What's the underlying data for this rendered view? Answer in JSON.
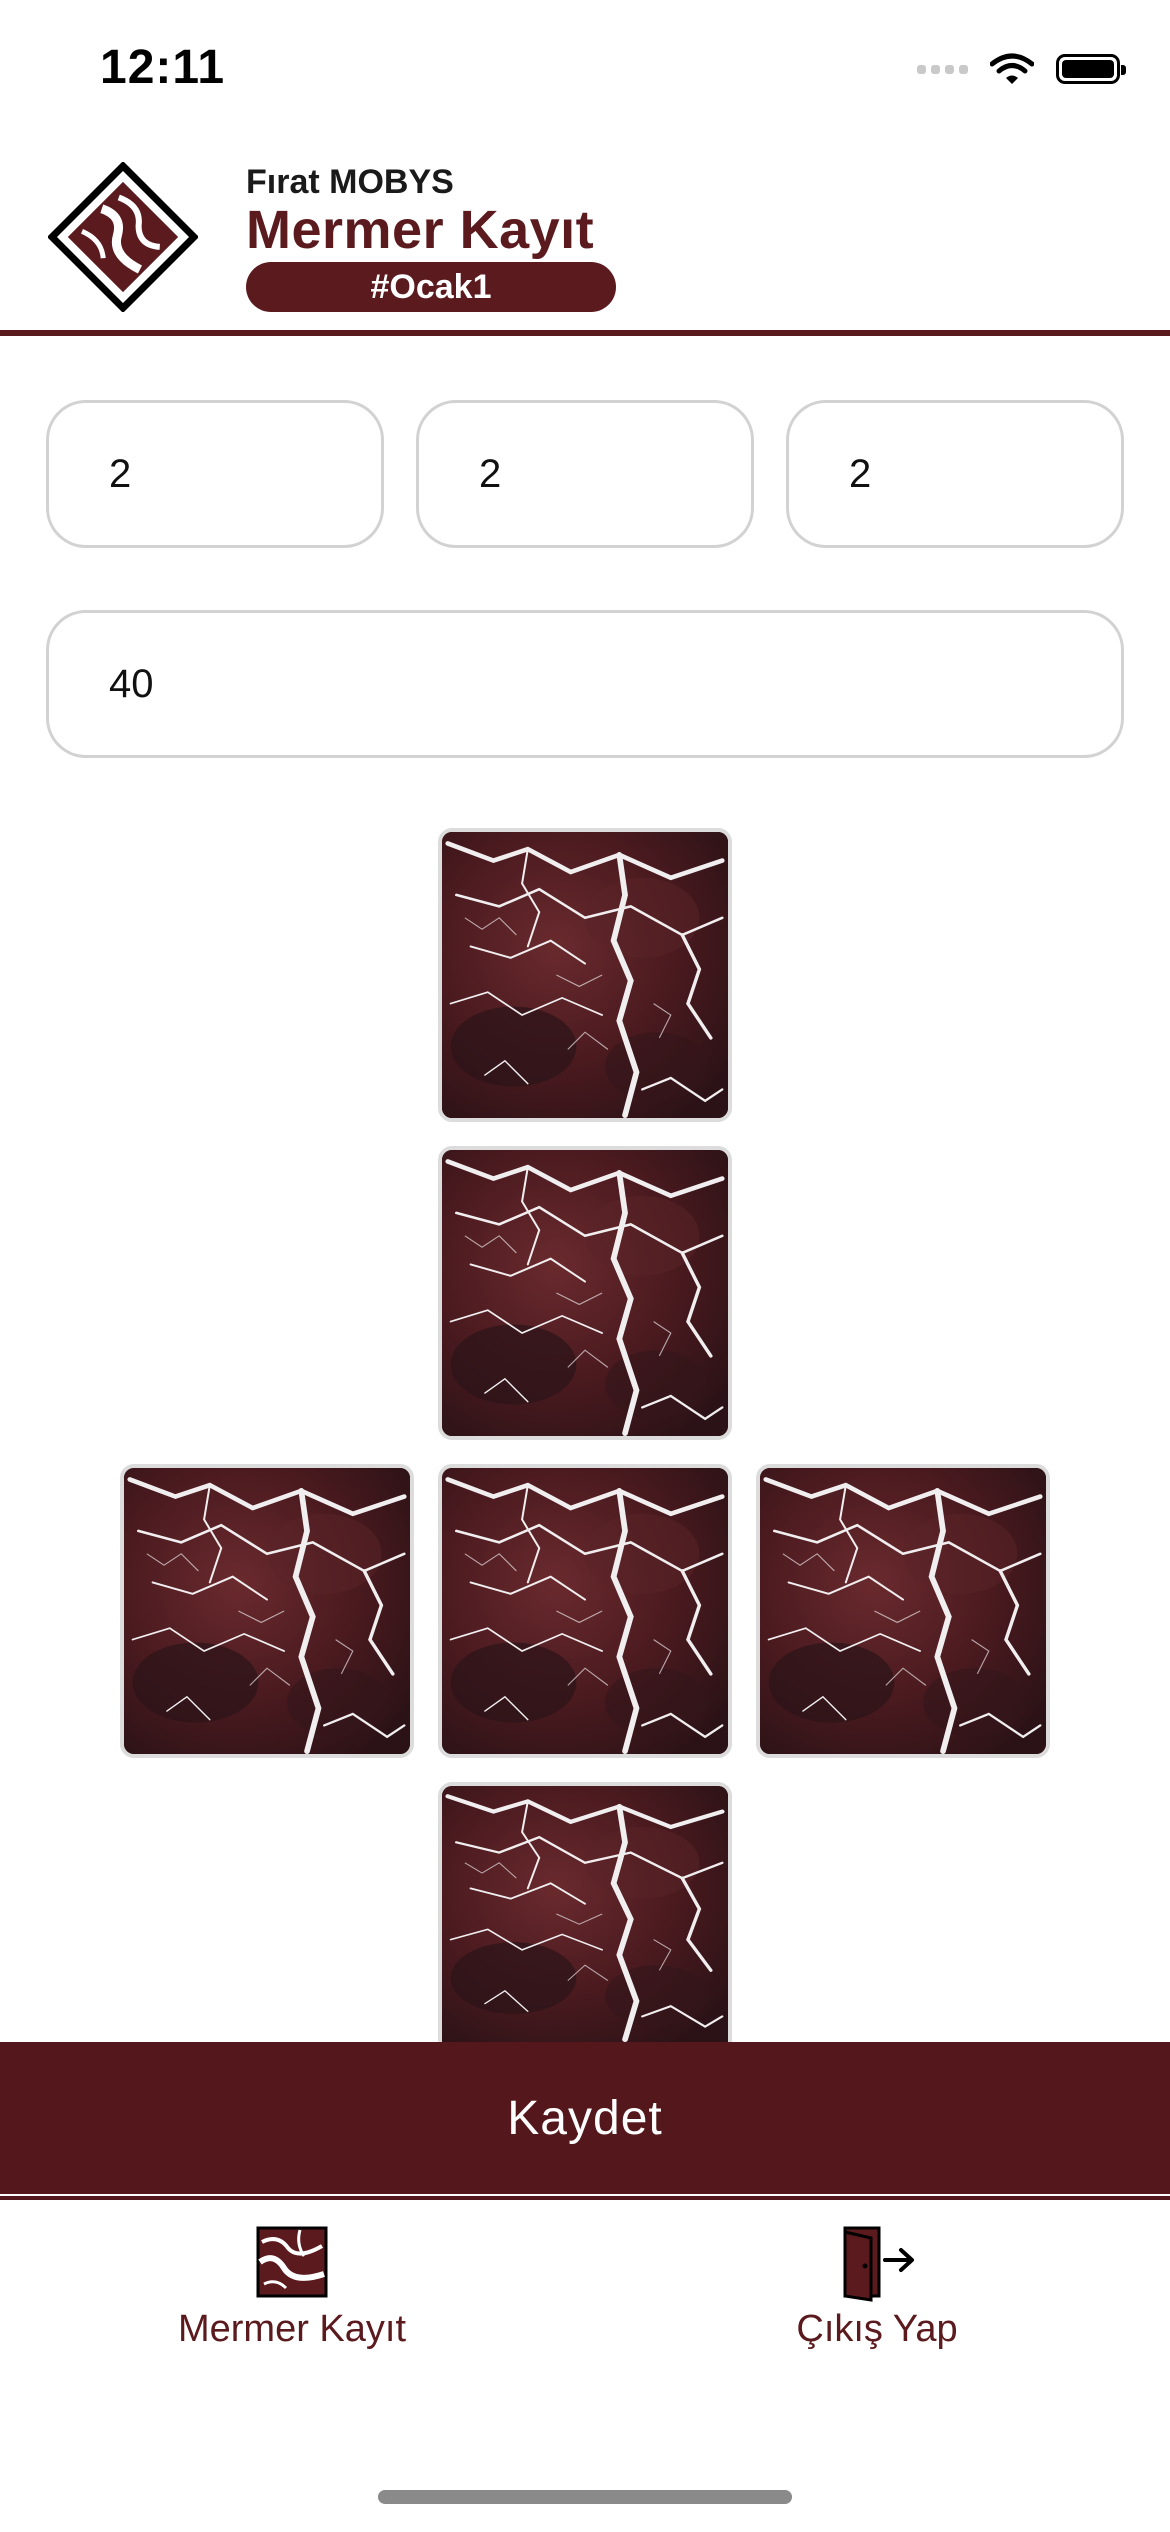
{
  "status_bar": {
    "time": "12:11"
  },
  "header": {
    "subtitle": "Fırat MOBYS",
    "title": "Mermer Kayıt",
    "tag": "#Ocak1",
    "brand_color": "#5b1a1e"
  },
  "form": {
    "field1_value": "2",
    "field2_value": "2",
    "field3_value": "2",
    "field4_value": "40"
  },
  "marble_layout": {
    "tile_count": 6,
    "tiles": [
      "top",
      "upper",
      "left",
      "center",
      "right",
      "bottom"
    ],
    "tile_color": "#3a1418"
  },
  "actions": {
    "save_label": "Kaydet",
    "save_color": "#54171b"
  },
  "bottom_nav": {
    "items": [
      {
        "label": "Mermer Kayıt",
        "icon": "marble-icon"
      },
      {
        "label": "Çıkış Yap",
        "icon": "exit-door-icon"
      }
    ]
  }
}
